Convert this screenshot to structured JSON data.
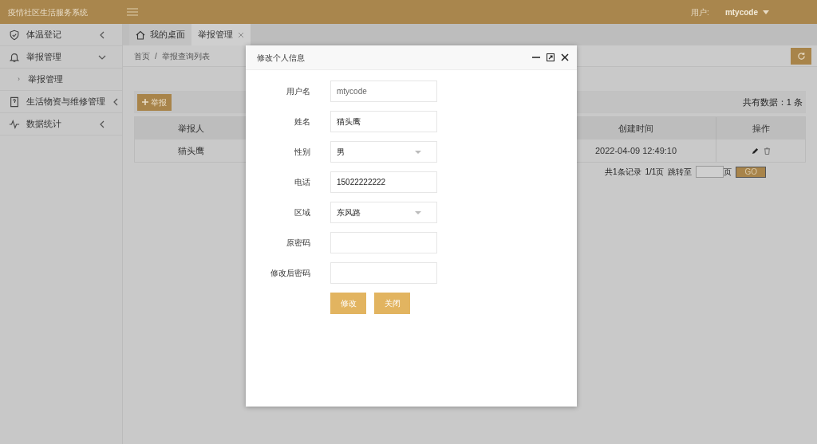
{
  "header": {
    "title": "疫情社区生活服务系统",
    "user_label": "用户:",
    "username": "mtycode"
  },
  "sidebar": {
    "items": [
      {
        "label": "体温登记",
        "expanded": false
      },
      {
        "label": "举报管理",
        "expanded": true,
        "children": [
          {
            "label": "举报管理",
            "marker": "›"
          }
        ]
      },
      {
        "label": "生活物资与维修管理",
        "expanded": false
      },
      {
        "label": "数据统计",
        "expanded": false
      }
    ]
  },
  "tabs": [
    {
      "label": "我的桌面",
      "selected": false,
      "closable": false
    },
    {
      "label": "举报管理",
      "selected": true,
      "closable": true
    }
  ],
  "breadcrumb": [
    "首页",
    "/",
    "举报查询列表"
  ],
  "toolbar": {
    "add_button": "举报",
    "total": "共有数据：1 条"
  },
  "table": {
    "columns": [
      "举报人",
      "创建时间",
      "操作"
    ],
    "rows": [
      {
        "reporter": "猫头鹰",
        "created": "2022-04-09 12:49:10"
      }
    ]
  },
  "pagination": {
    "records": "共1条记录",
    "pages": "1/1页",
    "jump_label": "跳转至",
    "page_unit": "页",
    "go": "GO"
  },
  "modal": {
    "title": "修改个人信息",
    "fields": [
      {
        "label": "用户名",
        "kind": "input",
        "value": "mtycode",
        "readonly": true
      },
      {
        "label": "姓名",
        "kind": "input",
        "value": "猫头鹰",
        "readonly": false
      },
      {
        "label": "性别",
        "kind": "select",
        "value": "男",
        "readonly": false
      },
      {
        "label": "电话",
        "kind": "input",
        "value": "15022222222",
        "readonly": false
      },
      {
        "label": "区域",
        "kind": "select",
        "value": "东风路",
        "readonly": false
      },
      {
        "label": "原密码",
        "kind": "input"
      },
      {
        "label": "修改后密码",
        "kind": "input"
      }
    ],
    "buttons": [
      "修改",
      "关闭"
    ]
  }
}
